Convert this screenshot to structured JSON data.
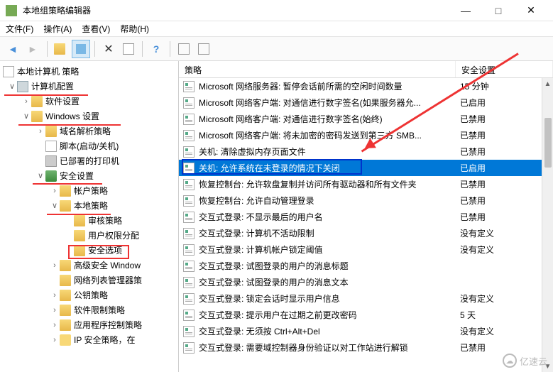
{
  "window": {
    "title": "本地组策略编辑器",
    "controls": {
      "min": "—",
      "max": "□",
      "close": "✕"
    }
  },
  "menu": {
    "file": "文件(F)",
    "action": "操作(A)",
    "view": "查看(V)",
    "help": "帮助(H)"
  },
  "toolbar_icons": {
    "back": "←",
    "forward": "→",
    "up": "↑",
    "delete": "✕",
    "copy": "⎘",
    "help": "?",
    "props": "▤",
    "list": "▦"
  },
  "tree": {
    "root": "本地计算机 策略",
    "computer_config": "计算机配置",
    "software_settings": "软件设置",
    "windows_settings": "Windows 设置",
    "name_resolution": "域名解析策略",
    "scripts": "脚本(启动/关机)",
    "deployed_printers": "已部署的打印机",
    "security_settings": "安全设置",
    "account_policies": "帐户策略",
    "local_policies": "本地策略",
    "audit_policy": "审核策略",
    "user_rights": "用户权限分配",
    "security_options": "安全选项",
    "adv_security": "高级安全 Window",
    "network_list": "网络列表管理器策",
    "public_key": "公钥策略",
    "software_restrict": "软件限制策略",
    "app_control": "应用程序控制策略",
    "ip_security": "IP 安全策略，在"
  },
  "list_head": {
    "policy": "策略",
    "setting": "安全设置"
  },
  "policies": [
    {
      "name": "Microsoft 网络服务器: 暂停会话前所需的空闲时间数量",
      "setting": "15 分钟"
    },
    {
      "name": "Microsoft 网络客户端: 对通信进行数字签名(如果服务器允...",
      "setting": "已启用"
    },
    {
      "name": "Microsoft 网络客户端: 对通信进行数字签名(始终)",
      "setting": "已禁用"
    },
    {
      "name": "Microsoft 网络客户端: 将未加密的密码发送到第三方 SMB...",
      "setting": "已禁用"
    },
    {
      "name": "关机: 清除虚拟内存页面文件",
      "setting": "已禁用"
    },
    {
      "name": "关机: 允许系统在未登录的情况下关闭",
      "setting": "已启用",
      "selected": true
    },
    {
      "name": "恢复控制台: 允许软盘复制并访问所有驱动器和所有文件夹",
      "setting": "已禁用"
    },
    {
      "name": "恢复控制台: 允许自动管理登录",
      "setting": "已禁用"
    },
    {
      "name": "交互式登录: 不显示最后的用户名",
      "setting": "已禁用"
    },
    {
      "name": "交互式登录: 计算机不活动限制",
      "setting": "没有定义"
    },
    {
      "name": "交互式登录: 计算机帐户锁定阈值",
      "setting": "没有定义"
    },
    {
      "name": "交互式登录: 试图登录的用户的消息标题",
      "setting": ""
    },
    {
      "name": "交互式登录: 试图登录的用户的消息文本",
      "setting": ""
    },
    {
      "name": "交互式登录: 锁定会话时显示用户信息",
      "setting": "没有定义"
    },
    {
      "name": "交互式登录: 提示用户在过期之前更改密码",
      "setting": "5 天"
    },
    {
      "name": "交互式登录: 无须按 Ctrl+Alt+Del",
      "setting": "没有定义"
    },
    {
      "name": "交互式登录: 需要域控制器身份验证以对工作站进行解锁",
      "setting": "已禁用"
    }
  ],
  "watermark": "亿速云"
}
